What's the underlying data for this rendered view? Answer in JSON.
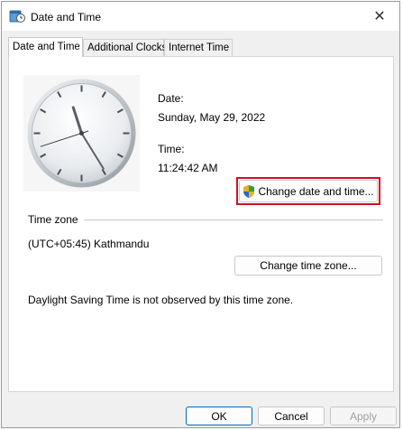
{
  "window": {
    "title": "Date and Time",
    "icon": "datetime-app-icon",
    "close_glyph": "✕"
  },
  "tabs": [
    {
      "label": "Date and Time",
      "active": true
    },
    {
      "label": "Additional Clocks",
      "active": false
    },
    {
      "label": "Internet Time",
      "active": false
    }
  ],
  "clock": {
    "hours": 11,
    "minutes": 24,
    "seconds": 42
  },
  "date": {
    "label": "Date:",
    "value": "Sunday, May 29, 2022"
  },
  "time": {
    "label": "Time:",
    "value": "11:24:42 AM"
  },
  "change_datetime_button": {
    "label": "Change date and time...",
    "icon": "uac-shield-icon"
  },
  "timezone": {
    "heading": "Time zone",
    "value": "(UTC+05:45) Kathmandu",
    "change_button": "Change time zone...",
    "dst_note": "Daylight Saving Time is not observed by this time zone."
  },
  "footer": {
    "ok": "OK",
    "cancel": "Cancel",
    "apply": "Apply"
  },
  "colors": {
    "highlight": "#d0101e",
    "primary_border": "#0067c0"
  }
}
